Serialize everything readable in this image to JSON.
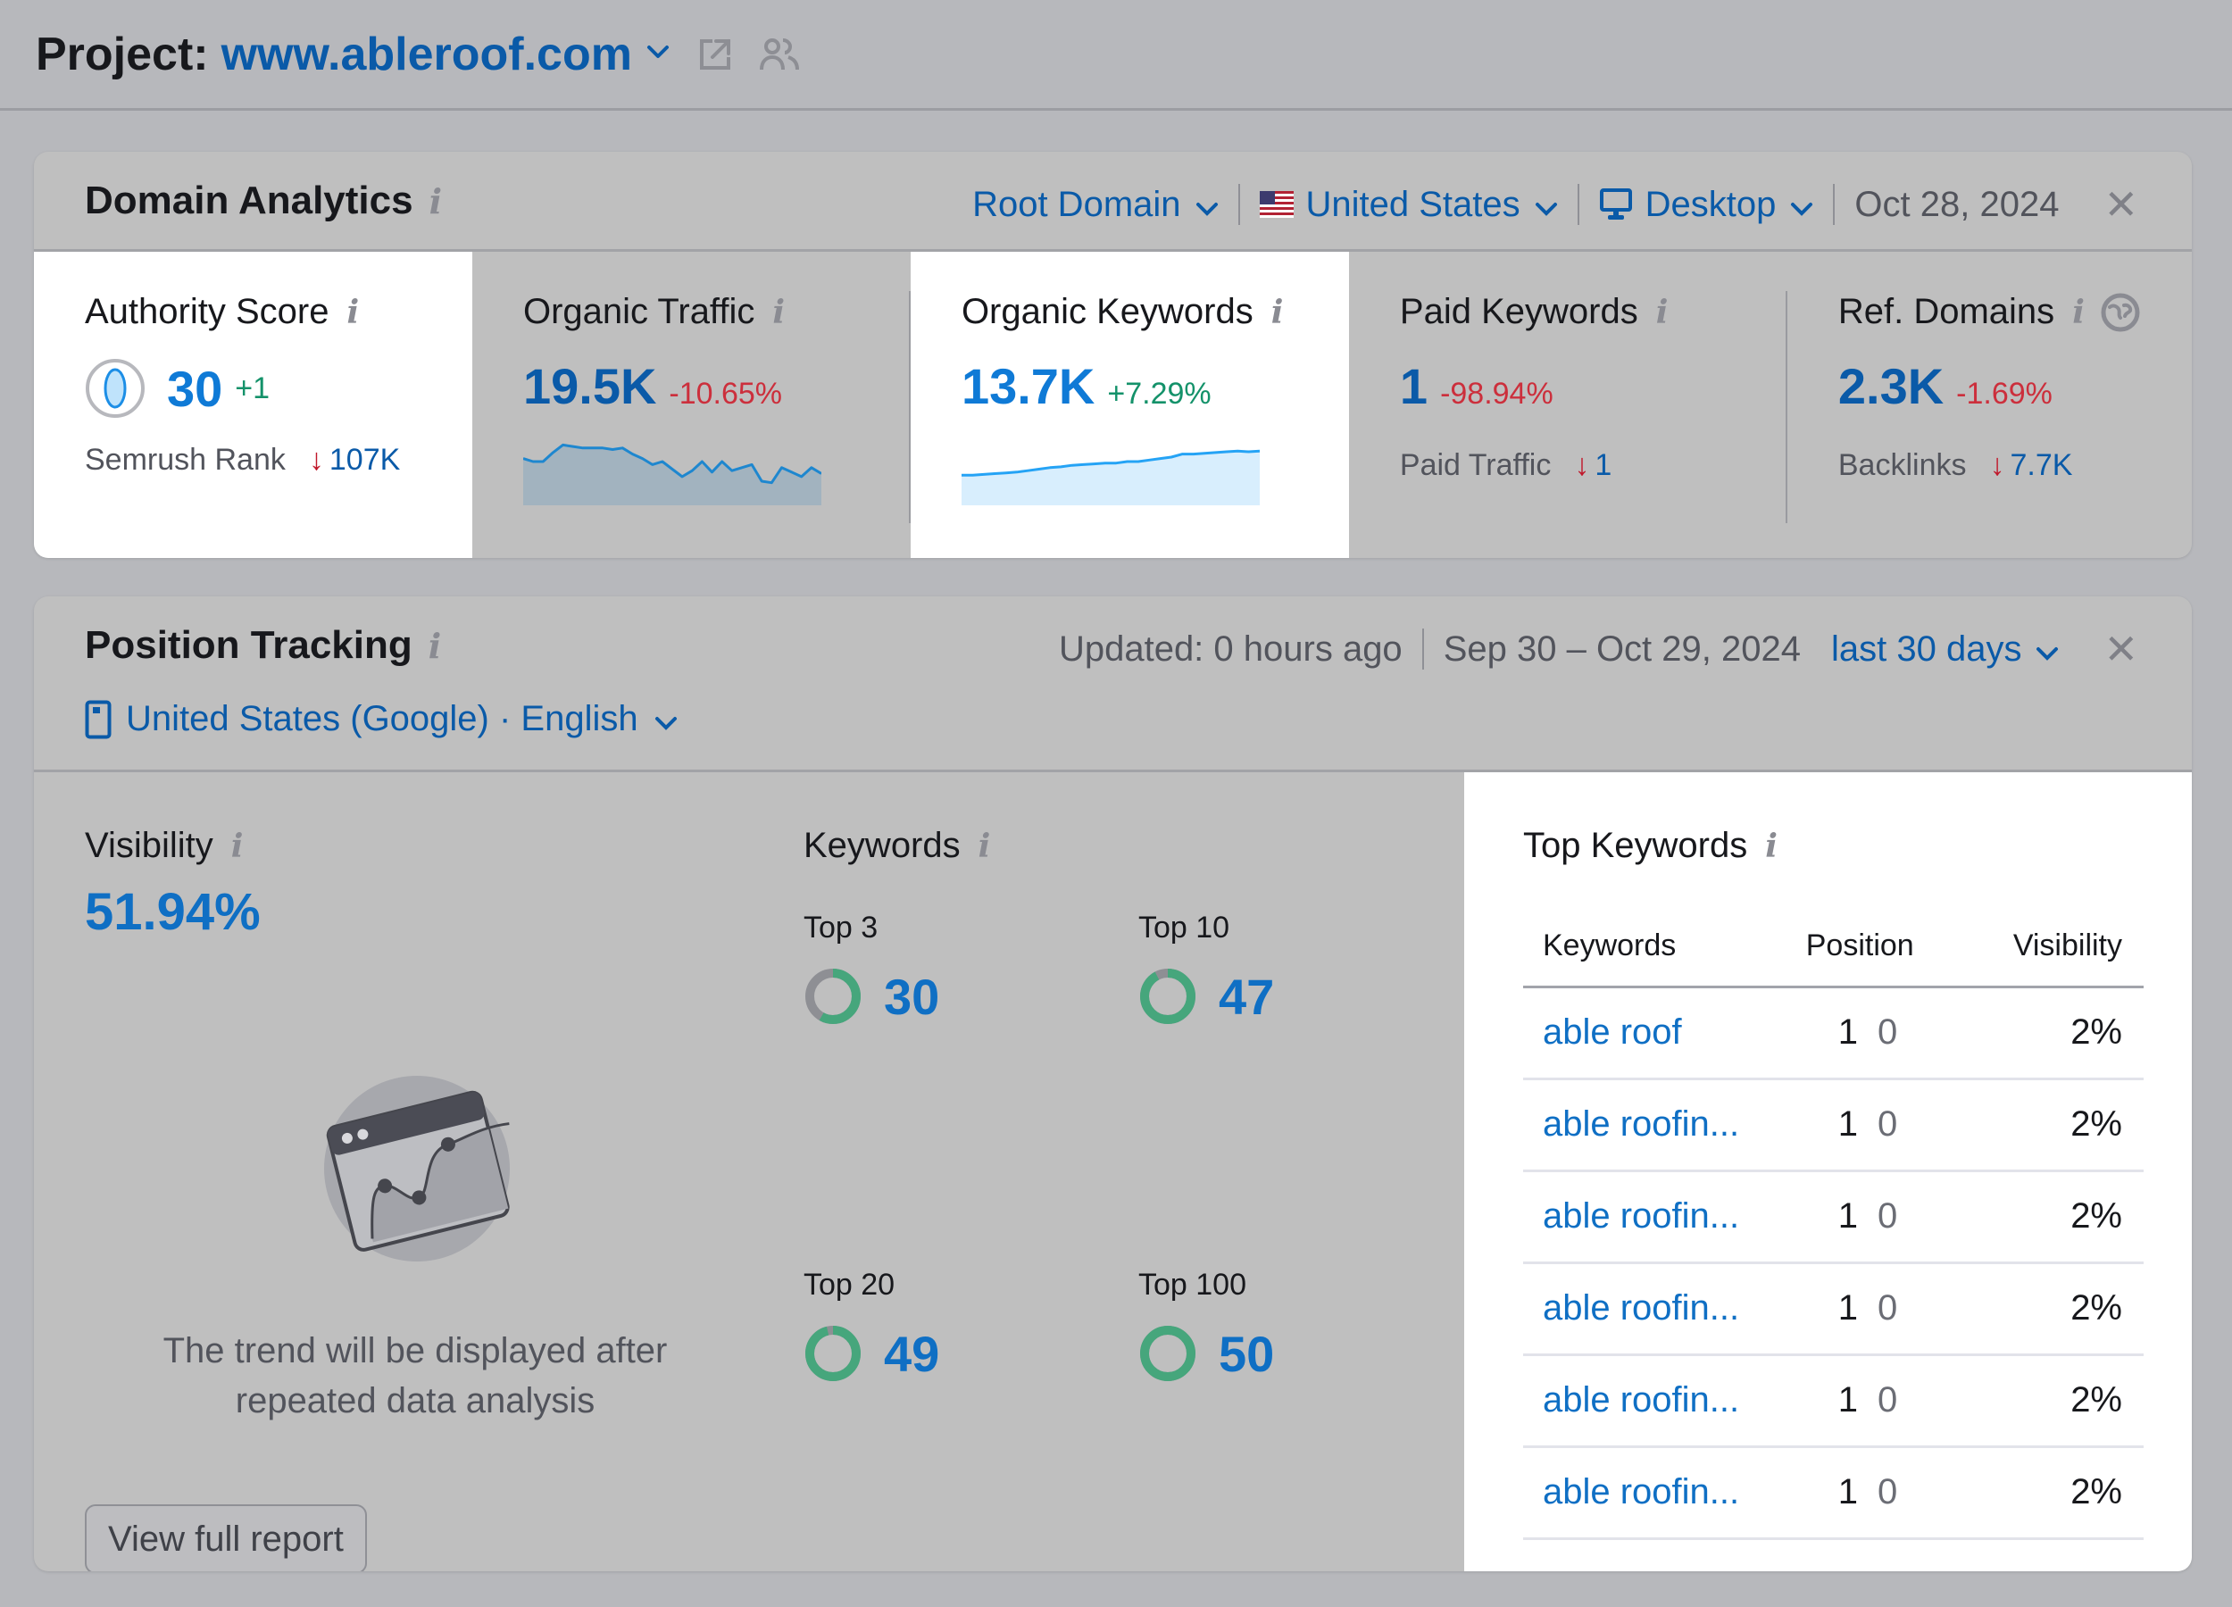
{
  "project": {
    "label": "Project:",
    "domain": "www.ableroof.com",
    "icons": [
      "chevron-down-icon",
      "external-link-icon",
      "users-icon"
    ]
  },
  "domain_analytics": {
    "title": "Domain Analytics",
    "controls": {
      "scope": "Root Domain",
      "country": "United States",
      "device": "Desktop",
      "date": "Oct 28, 2024"
    },
    "metrics": [
      {
        "label": "Authority Score",
        "value": "30",
        "delta": "+1",
        "delta_type": "positive",
        "sub_label": "Semrush Rank",
        "sub_value": "107K",
        "sub_trend": "down",
        "highlight": true
      },
      {
        "label": "Organic Traffic",
        "value": "19.5K",
        "delta": "-10.65%",
        "delta_type": "negative",
        "sparkline": [
          62,
          58,
          58,
          70,
          80,
          78,
          76,
          76,
          76,
          74,
          76,
          68,
          62,
          54,
          58,
          48,
          38,
          46,
          58,
          44,
          58,
          46,
          50,
          54,
          32,
          30,
          50,
          44,
          38,
          50,
          42
        ],
        "highlight": false
      },
      {
        "label": "Organic Keywords",
        "value": "13.7K",
        "delta": "+7.29%",
        "delta_type": "positive",
        "sparkline": [
          40,
          40,
          41,
          42,
          43,
          44,
          46,
          48,
          50,
          51,
          53,
          54,
          55,
          56,
          56,
          58,
          58,
          60,
          62,
          64,
          68,
          68,
          69,
          70,
          71,
          72,
          71,
          72
        ],
        "highlight": true
      },
      {
        "label": "Paid Keywords",
        "value": "1",
        "delta": "-98.94%",
        "delta_type": "negative",
        "sub_label": "Paid Traffic",
        "sub_value": "1",
        "sub_trend": "down",
        "highlight": false
      },
      {
        "label": "Ref. Domains",
        "value": "2.3K",
        "delta": "-1.69%",
        "delta_type": "negative",
        "sub_label": "Backlinks",
        "sub_value": "7.7K",
        "sub_trend": "down",
        "highlight": false
      }
    ]
  },
  "position_tracking": {
    "title": "Position Tracking",
    "location": "United States (Google) · English",
    "updated": "Updated: 0 hours ago",
    "date_range": "Sep 30 – Oct 29, 2024",
    "period": "last 30 days",
    "visibility": {
      "label": "Visibility",
      "value": "51.94%",
      "empty_message_line1": "The trend will be displayed after",
      "empty_message_line2": "repeated data analysis",
      "button": "View full report"
    },
    "keywords": {
      "label": "Keywords",
      "total": 50,
      "buckets": [
        {
          "label": "Top 3",
          "value": 30
        },
        {
          "label": "Top 10",
          "value": 47
        },
        {
          "label": "Top 20",
          "value": 49
        },
        {
          "label": "Top 100",
          "value": 50
        }
      ]
    },
    "top_keywords": {
      "title": "Top Keywords",
      "columns": [
        "Keywords",
        "Position",
        "Visibility"
      ],
      "rows": [
        {
          "keyword": "able roof",
          "position": "1",
          "change": "0",
          "visibility": "2%"
        },
        {
          "keyword": "able roofin...",
          "position": "1",
          "change": "0",
          "visibility": "2%"
        },
        {
          "keyword": "able roofin...",
          "position": "1",
          "change": "0",
          "visibility": "2%"
        },
        {
          "keyword": "able roofin...",
          "position": "1",
          "change": "0",
          "visibility": "2%"
        },
        {
          "keyword": "able roofin...",
          "position": "1",
          "change": "0",
          "visibility": "2%"
        },
        {
          "keyword": "able roofin...",
          "position": "1",
          "change": "0",
          "visibility": "2%"
        }
      ]
    }
  },
  "colors": {
    "link_blue": "#0a5aa8",
    "value_blue": "#0f7ad6",
    "positive": "#14926a",
    "negative": "#cc2f3c",
    "donut_fill": "#46a67c",
    "donut_empty": "#8e8f94"
  }
}
